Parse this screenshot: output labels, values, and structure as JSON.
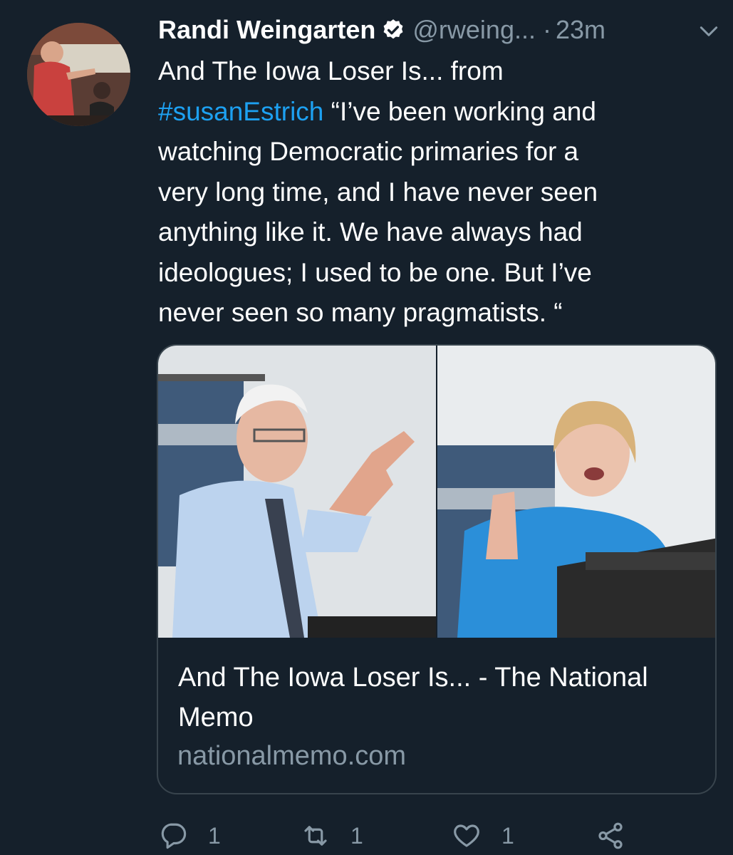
{
  "tweet": {
    "author_name": "Randi Weingarten",
    "handle": "@rweing...",
    "separator": "·",
    "time": "23m",
    "text_line1": "And The Iowa Loser Is... from",
    "hashtag": "#susanEstrich",
    "text_after_hashtag": " “I’ve been working and\nwatching Democratic primaries for a\nvery long time, and I have never seen\nanything like it. We have always had\nideologues; I used to be one. But I’ve\nnever seen so many pragmatists. “"
  },
  "card": {
    "title": "And The Iowa Loser Is... - The National Memo",
    "domain": "nationalmemo.com"
  },
  "actions": {
    "reply_count": "1",
    "retweet_count": "1",
    "like_count": "1"
  },
  "colors": {
    "background": "#15202b",
    "text": "#ffffff",
    "secondary": "#8899a6",
    "link": "#1da1f2",
    "border": "#38444d"
  },
  "icons": [
    "verified-badge-icon",
    "chevron-down-icon",
    "reply-icon",
    "retweet-icon",
    "like-icon",
    "share-icon"
  ]
}
